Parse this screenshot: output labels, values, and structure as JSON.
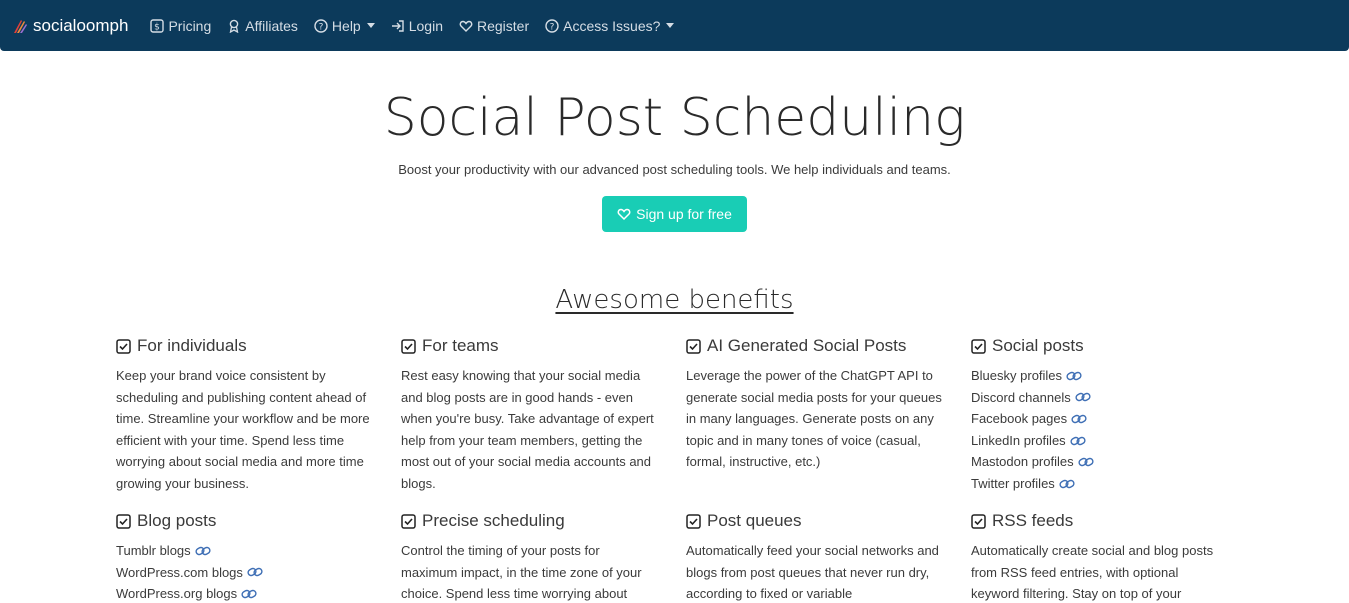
{
  "navbar": {
    "brand": "socialoomph",
    "items": [
      {
        "label": "Pricing",
        "icon": "dollar-icon"
      },
      {
        "label": "Affiliates",
        "icon": "award-icon"
      },
      {
        "label": "Help",
        "icon": "question-circle-icon",
        "dropdown": true
      },
      {
        "label": "Login",
        "icon": "login-arrow-icon"
      },
      {
        "label": "Register",
        "icon": "heart-icon"
      },
      {
        "label": "Access Issues?",
        "icon": "question-circle-icon",
        "dropdown": true
      }
    ]
  },
  "hero": {
    "title": "Social Post Scheduling",
    "subtitle": "Boost your productivity with our advanced post scheduling tools. We help individuals and teams.",
    "cta_label": "Sign up for free"
  },
  "benefits_title": "Awesome benefits",
  "benefits": {
    "individuals": {
      "title": "For individuals",
      "text": "Keep your brand voice consistent by scheduling and publishing content ahead of time. Streamline your workflow and be more efficient with your time. Spend less time worrying about social media and more time growing your business."
    },
    "teams": {
      "title": "For teams",
      "text": "Rest easy knowing that your social media and blog posts are in good hands - even when you're busy. Take advantage of expert help from your team members, getting the most out of your social media accounts and blogs."
    },
    "ai": {
      "title": "AI Generated Social Posts",
      "text": "Leverage the power of the ChatGPT API to generate social media posts for your queues in many languages. Generate posts on any topic and in many tones of voice (casual, formal, instructive, etc.)"
    },
    "social": {
      "title": "Social posts",
      "items": [
        "Bluesky profiles",
        "Discord channels",
        "Facebook pages",
        "LinkedIn profiles",
        "Mastodon profiles",
        "Twitter profiles"
      ]
    },
    "blog": {
      "title": "Blog posts",
      "items": [
        "Tumblr blogs",
        "WordPress.com blogs",
        "WordPress.org blogs"
      ]
    },
    "precise": {
      "title": "Precise scheduling",
      "text": "Control the timing of your posts for maximum impact, in the time zone of your choice. Spend less time worrying about"
    },
    "queues": {
      "title": "Post queues",
      "text": "Automatically feed your social networks and blogs from post queues that never run dry, according to fixed or variable"
    },
    "rss": {
      "title": "RSS feeds",
      "text": "Automatically create social and blog posts from RSS feed entries, with optional keyword filtering. Stay on top of your"
    }
  },
  "colors": {
    "navbar_bg": "#0c3a5b",
    "cta_bg": "#19cdb5",
    "link_icon": "#3f6fb5"
  }
}
